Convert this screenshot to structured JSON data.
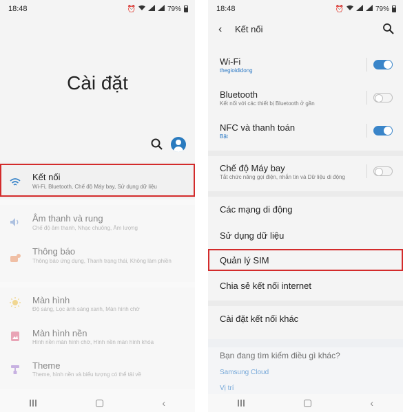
{
  "status": {
    "time": "18:48",
    "battery": "79%"
  },
  "left": {
    "page_title": "Cài đặt",
    "items": [
      {
        "title": "Kết nối",
        "sub": "Wi-Fi, Bluetooth, Chế độ Máy bay, Sử dụng dữ liệu",
        "icon": "wifi-icon"
      },
      {
        "title": "Âm thanh và rung",
        "sub": "Chế độ âm thanh, Nhạc chuông, Âm lượng",
        "icon": "volume-icon"
      },
      {
        "title": "Thông báo",
        "sub": "Thông báo ứng dụng, Thanh trạng thái, Không làm phiền",
        "icon": "notification-icon"
      },
      {
        "title": "Màn hình",
        "sub": "Độ sáng, Lọc ánh sáng xanh, Màn hình chờ",
        "icon": "brightness-icon"
      },
      {
        "title": "Màn hình nền",
        "sub": "Hình nền màn hình chờ, Hình nền màn hình khóa",
        "icon": "wallpaper-icon"
      },
      {
        "title": "Theme",
        "sub": "Theme, hình nền và biểu tượng có thể tải về",
        "icon": "theme-icon"
      }
    ]
  },
  "right": {
    "header_title": "Kết nối",
    "items": [
      {
        "title": "Wi-Fi",
        "sub": "thegioididong",
        "toggle": "on"
      },
      {
        "title": "Bluetooth",
        "sub": "Kết nối với các thiết bị Bluetooth ở gần",
        "toggle": "off"
      },
      {
        "title": "NFC và thanh toán",
        "sub": "Bật",
        "toggle": "on"
      },
      {
        "title": "Chế độ Máy bay",
        "sub": "Tắt chức năng gọi điện, nhắn tin và Dữ liệu di động",
        "toggle": "off"
      },
      {
        "title": "Các mạng di động"
      },
      {
        "title": "Sử dụng dữ liệu"
      },
      {
        "title": "Quản lý SIM"
      },
      {
        "title": "Chia sẻ kết nối internet"
      },
      {
        "title": "Cài đặt kết nối khác"
      }
    ],
    "suggest": {
      "title": "Bạn đang tìm kiếm điều gì khác?",
      "links": [
        "Samsung Cloud",
        "Vị trí"
      ]
    }
  },
  "colors": {
    "accent": "#3a85c9",
    "highlight": "#d32b2b",
    "link": "#2a78c4"
  }
}
